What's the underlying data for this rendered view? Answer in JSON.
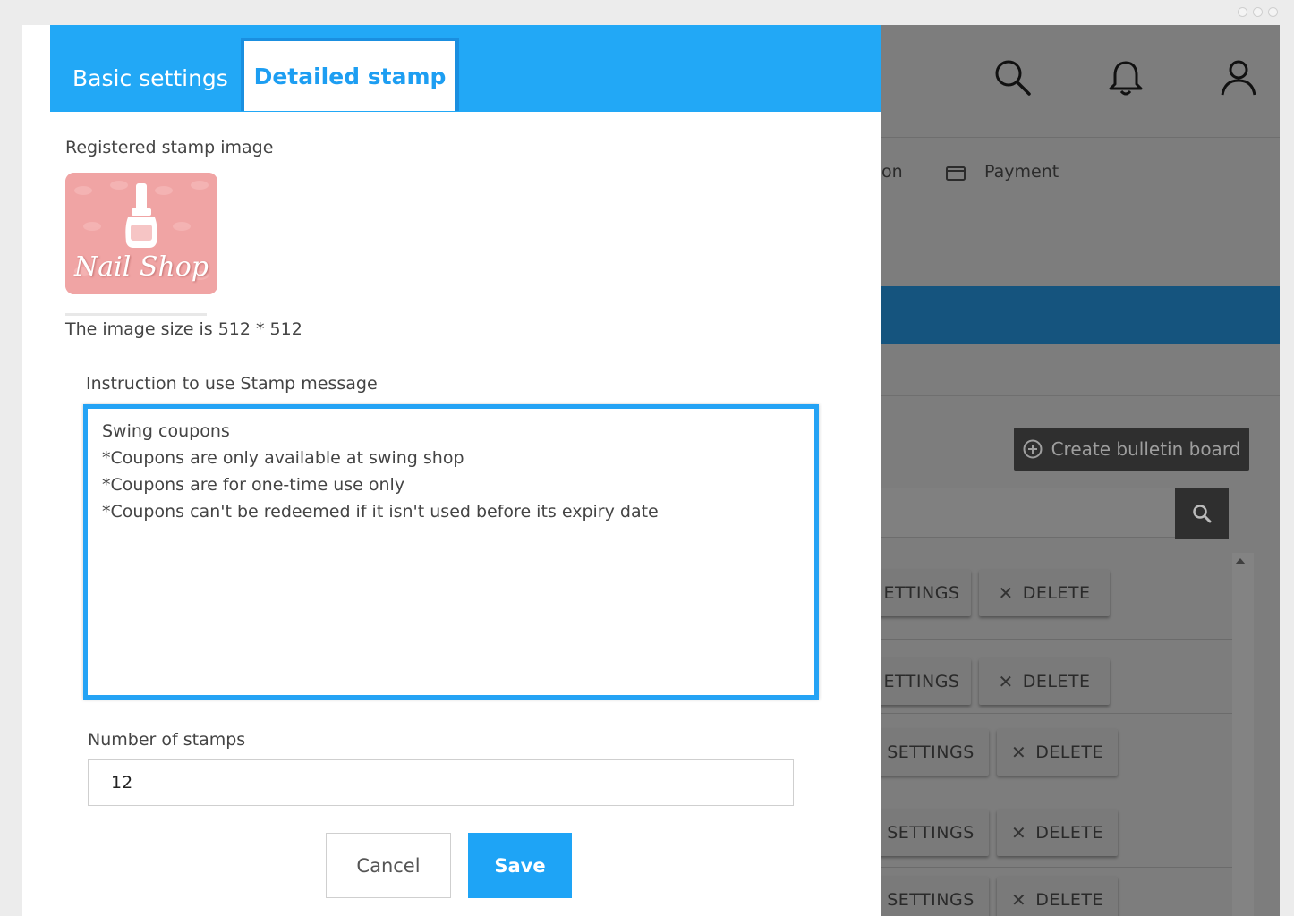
{
  "modal": {
    "tabs": {
      "basic": "Basic settings",
      "detailed": "Detailed stamp"
    },
    "registered_label": "Registered stamp image",
    "stamp_text": "Nail Shop",
    "image_size_text": "The image size is 512 * 512",
    "instruction_label": "Instruction to use Stamp message",
    "instruction_value": "Swing coupons\n*Coupons are only available at swing shop\n*Coupons are for one-time use only\n*Coupons can't be redeemed if it isn't used before its expiry date",
    "stamps_label": "Number of stamps",
    "stamps_value": "12",
    "cancel": "Cancel",
    "save": "Save"
  },
  "background": {
    "nav_partial": "on",
    "nav_payment": "Payment",
    "create_button": "Create bulletin board",
    "rows": [
      {
        "settings": "ETTINGS",
        "delete": "DELETE"
      },
      {
        "settings": "ETTINGS",
        "delete": "DELETE"
      },
      {
        "settings": "SETTINGS",
        "delete": "DELETE"
      },
      {
        "settings": "SETTINGS",
        "delete": "DELETE"
      },
      {
        "settings": "SETTINGS",
        "delete": "DELETE"
      }
    ]
  },
  "colors": {
    "accent": "#22a8f6",
    "dark_bar": "#15547e"
  },
  "icons": [
    "search-icon",
    "bell-icon",
    "user-icon",
    "card-icon",
    "plus-circle-icon",
    "close-icon"
  ]
}
